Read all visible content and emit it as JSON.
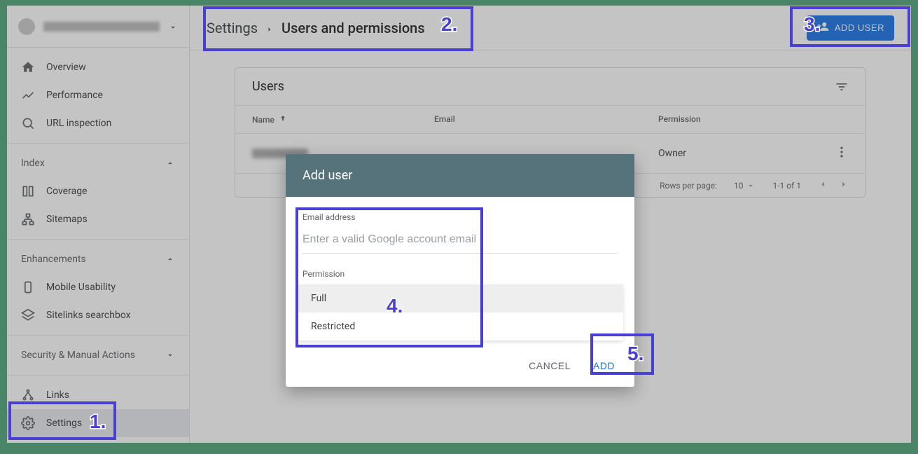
{
  "sidebar": {
    "main_items": [
      {
        "icon": "home",
        "label": "Overview"
      },
      {
        "icon": "trending",
        "label": "Performance"
      },
      {
        "icon": "search",
        "label": "URL inspection"
      }
    ],
    "groups": [
      {
        "title": "Index",
        "items": [
          {
            "icon": "coverage",
            "label": "Coverage"
          },
          {
            "icon": "sitemap",
            "label": "Sitemaps"
          }
        ]
      },
      {
        "title": "Enhancements",
        "items": [
          {
            "icon": "mobile",
            "label": "Mobile Usability"
          },
          {
            "icon": "sitelinks",
            "label": "Sitelinks searchbox"
          }
        ]
      },
      {
        "title": "Security & Manual Actions",
        "items": []
      }
    ],
    "bottom_items": [
      {
        "icon": "links",
        "label": "Links"
      },
      {
        "icon": "gear",
        "label": "Settings"
      }
    ]
  },
  "header": {
    "breadcrumb": [
      "Settings",
      "Users and permissions"
    ],
    "add_user_label": "ADD USER"
  },
  "card": {
    "title": "Users",
    "columns": [
      "Name",
      "Email",
      "Permission"
    ],
    "rows": [
      {
        "name": "",
        "email": "",
        "permission": "Owner"
      }
    ],
    "footer": {
      "rpp_label": "Rows per page:",
      "rpp_value": "10",
      "range": "1-1 of 1"
    }
  },
  "dialog": {
    "title": "Add user",
    "email_label": "Email address",
    "email_placeholder": "Enter a valid Google account email",
    "permission_label": "Permission",
    "permission_options": [
      "Full",
      "Restricted"
    ],
    "cancel_label": "CANCEL",
    "add_label": "ADD"
  },
  "annotations": [
    "1",
    "2",
    "3",
    "4",
    "5"
  ]
}
